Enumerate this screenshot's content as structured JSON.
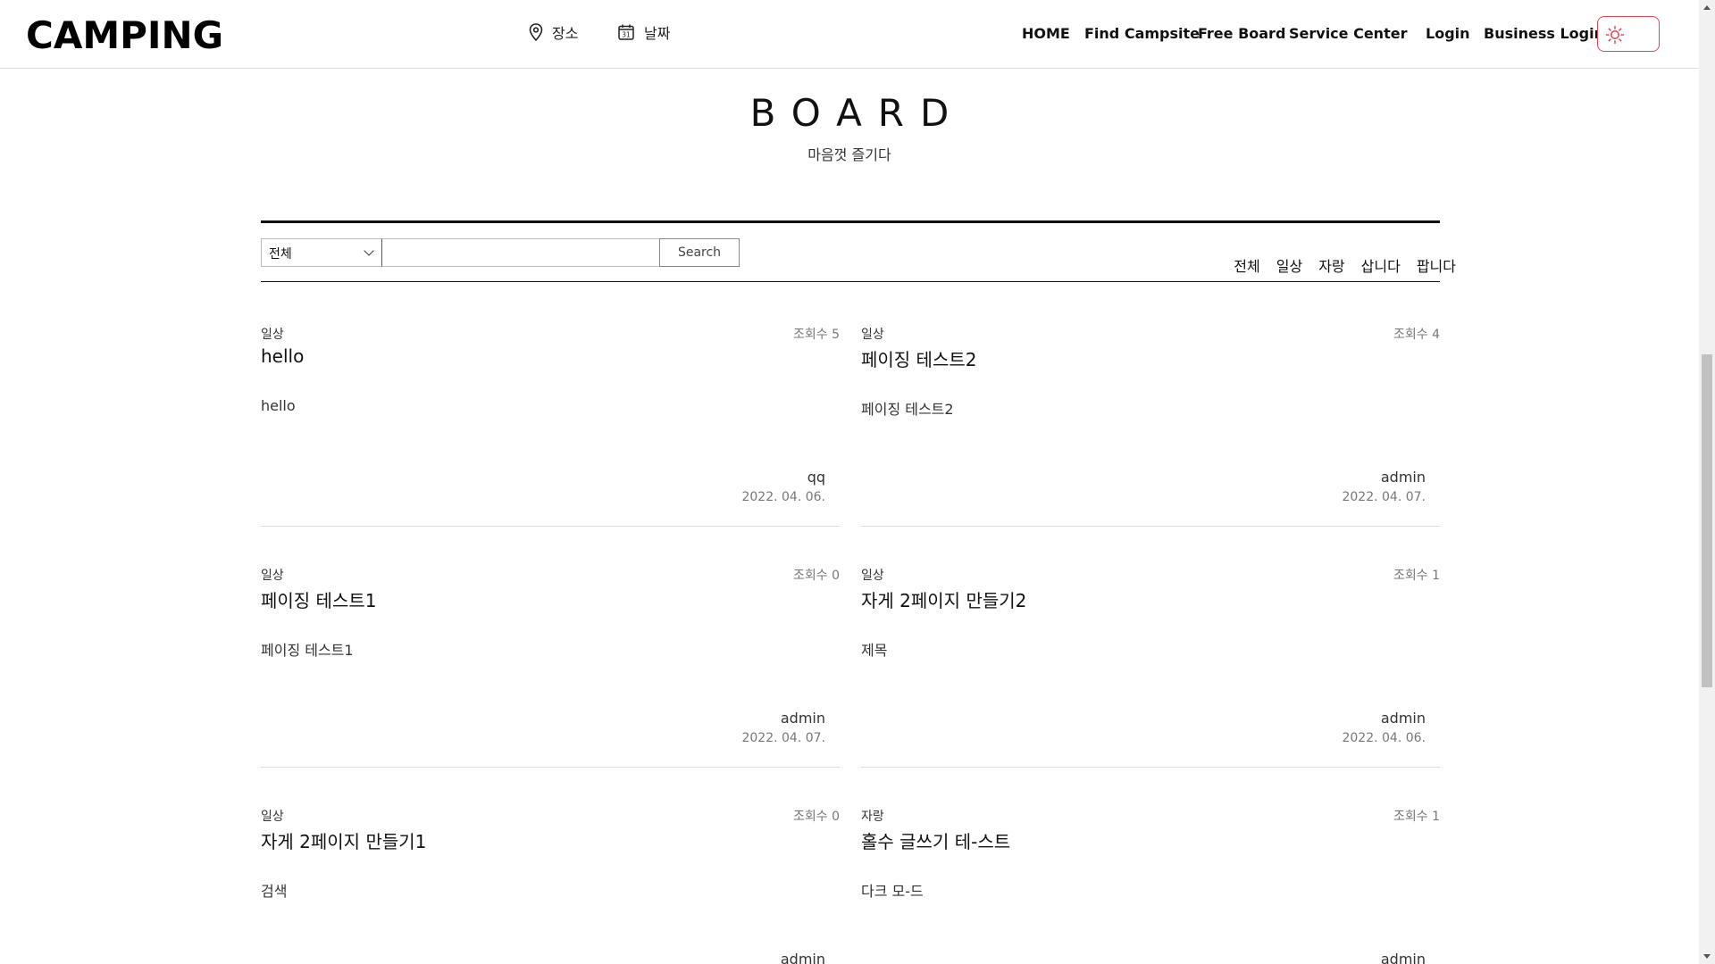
{
  "header": {
    "logo": "CAMPING",
    "place_label": "장소",
    "date_label": "날짜",
    "date_icon_day": "31",
    "nav": [
      "HOME",
      "Find Campsite",
      "Free Board",
      "Service Center",
      "Login",
      "Business Login"
    ],
    "theme_icon": "sun-icon",
    "accent_color": "#e8434d"
  },
  "board": {
    "title": "BOARD",
    "subtitle": "마음껏 즐기다"
  },
  "search": {
    "select_value": "전체",
    "input_value": "",
    "button_label": "Search"
  },
  "categories": [
    "전체",
    "일상",
    "자랑",
    "삽니다",
    "팝니다"
  ],
  "views_prefix": "조회수",
  "posts": [
    {
      "category": "일상",
      "views": "조회수 5",
      "title": "hello",
      "body": "hello",
      "author": "qq",
      "date": "2022. 04. 06."
    },
    {
      "category": "일상",
      "views": "조회수 4",
      "title": "페이징 테스트2",
      "body": "페이징 테스트2",
      "author": "admin",
      "date": "2022. 04. 07."
    },
    {
      "category": "일상",
      "views": "조회수 0",
      "title": "페이징 테스트1",
      "body": "페이징 테스트1",
      "author": "admin",
      "date": "2022. 04. 07."
    },
    {
      "category": "일상",
      "views": "조회수 1",
      "title": "자게 2페이지 만들기2",
      "body": "제목",
      "author": "admin",
      "date": "2022. 04. 06."
    },
    {
      "category": "일상",
      "views": "조회수 0",
      "title": "자게 2페이지 만들기1",
      "body": "검색",
      "author": "admin",
      "date": ""
    },
    {
      "category": "자랑",
      "views": "조회수 1",
      "title": "홀수 글쓰기 테-스트",
      "body": "다크 모-드",
      "author": "admin",
      "date": ""
    }
  ]
}
